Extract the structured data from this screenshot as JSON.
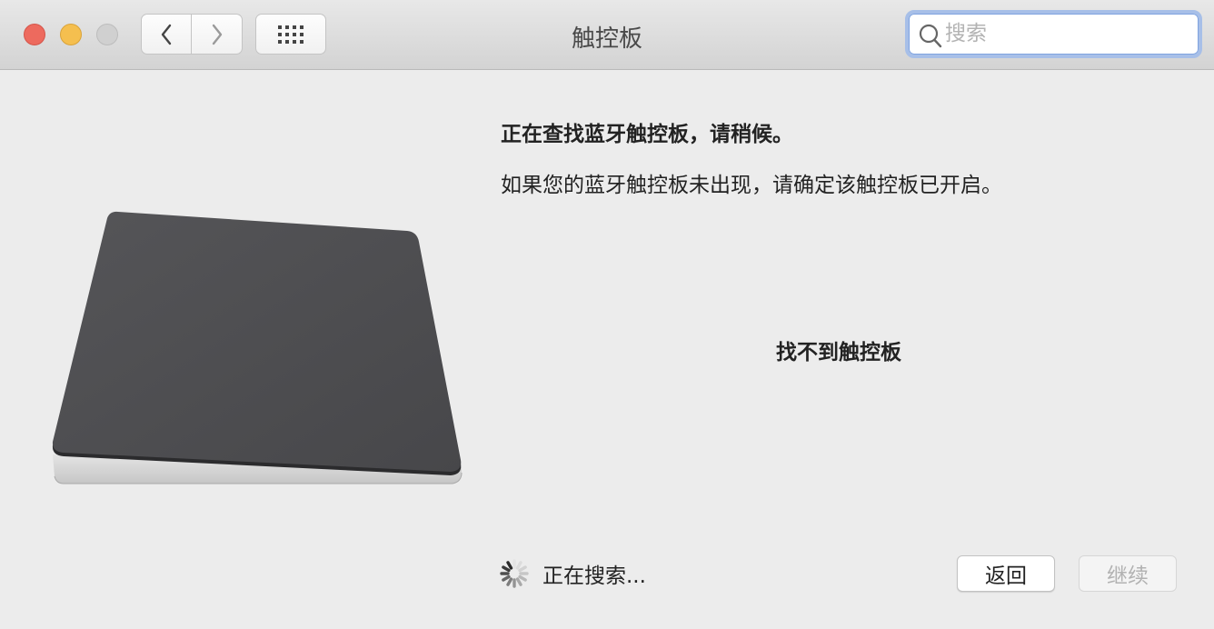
{
  "window": {
    "title": "触控板",
    "colors": {
      "close": "#ed6a5e",
      "minimize": "#f5bf4f",
      "zoom_disabled": "#d0d0d0",
      "search_focus": "#a7bfe8"
    }
  },
  "toolbar": {
    "back_icon": "chevron-left-icon",
    "forward_icon": "chevron-right-icon",
    "show_all_icon": "grid-icon",
    "search": {
      "placeholder": "搜索",
      "value": "",
      "icon": "search-icon"
    }
  },
  "main": {
    "heading": "正在查找蓝牙触控板，请稍候。",
    "instruction": "如果您的蓝牙触控板未出现，请确定该触控板已开启。",
    "not_found": "找不到触控板",
    "status_text": "正在搜索...",
    "illustration": "trackpad-illustration"
  },
  "buttons": {
    "back_label": "返回",
    "continue_label": "继续",
    "continue_enabled": false
  }
}
